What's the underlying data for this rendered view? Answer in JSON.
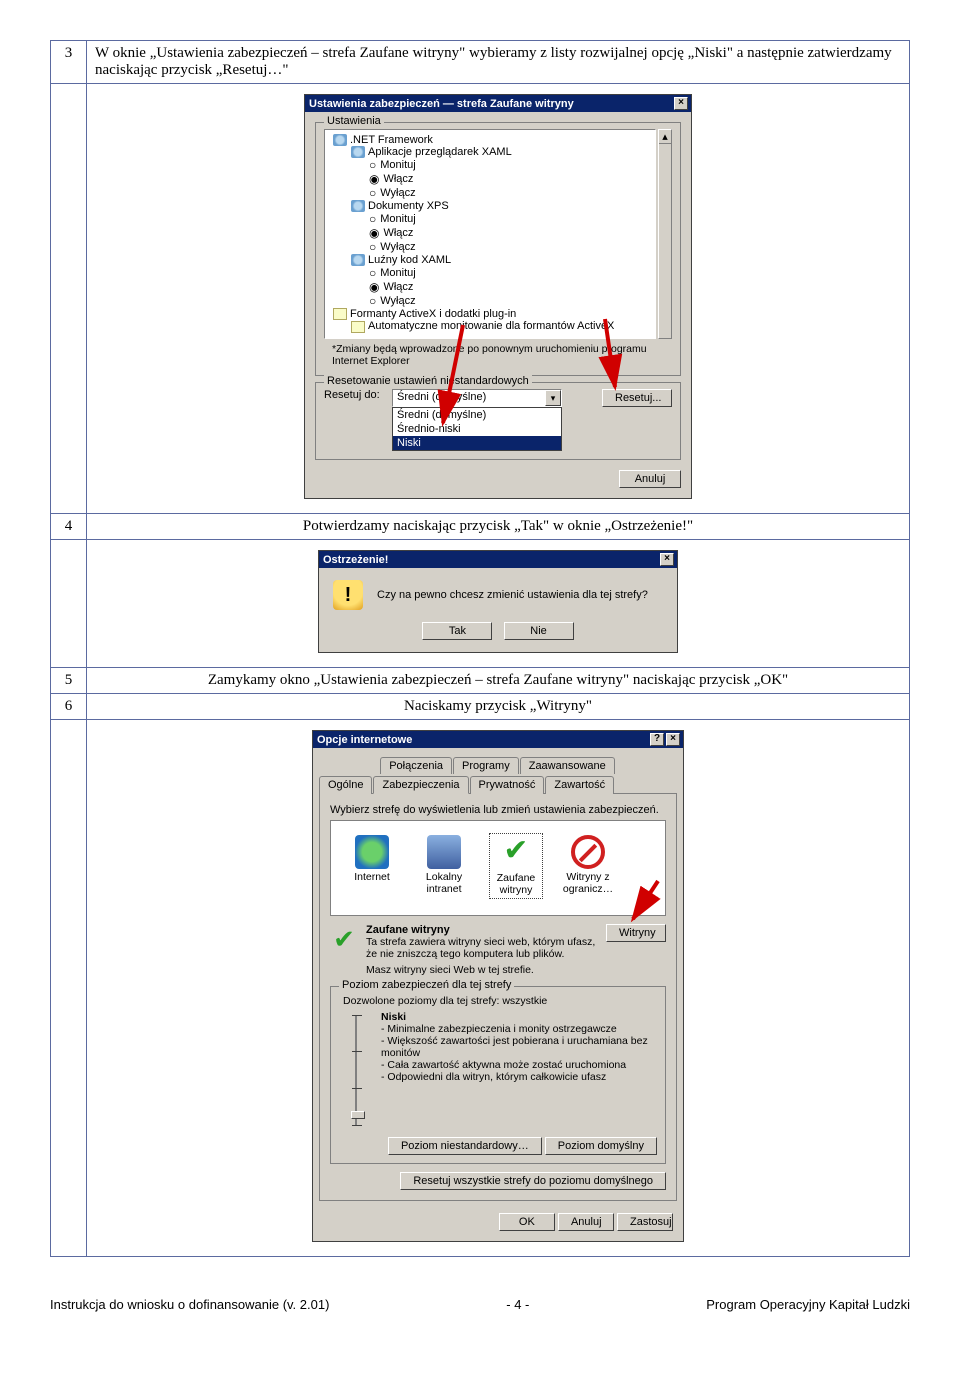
{
  "steps": {
    "s3": {
      "num": "3",
      "text": "W oknie „Ustawienia zabezpieczeń – strefa Zaufane witryny\" wybieramy z listy rozwijalnej opcję „Niski\" a następnie zatwierdzamy naciskając przycisk „Resetuj…\""
    },
    "s4": {
      "num": "4",
      "text": "Potwierdzamy naciskając przycisk „Tak\" w oknie „Ostrzeżenie!\""
    },
    "s5": {
      "num": "5",
      "text": "Zamykamy okno „Ustawienia zabezpieczeń – strefa Zaufane witryny\" naciskając przycisk „OK\""
    },
    "s6": {
      "num": "6",
      "text": "Naciskamy przycisk „Witryny\""
    }
  },
  "dlg1": {
    "title": "Ustawienia zabezpieczeń — strefa Zaufane witryny",
    "group_settings": "Ustawienia",
    "tree": {
      "net": ".NET Framework",
      "xaml_apps": "Aplikacje przeglądarek XAML",
      "monituj": "Monituj",
      "wlacz": "Włącz",
      "wylacz": "Wyłącz",
      "xps": "Dokumenty XPS",
      "loose_xaml": "Luźny kod XAML",
      "activex": "Formanty ActiveX i dodatki plug-in",
      "activex_auto": "Automatyczne monitowanie dla formantów ActiveX"
    },
    "note": "*Zmiany będą wprowadzone po ponownym uruchomieniu programu Internet Explorer",
    "group_reset": "Resetowanie ustawień niestandardowych",
    "reset_to": "Resetuj do:",
    "reset_btn": "Resetuj...",
    "combo": {
      "current": "Średni (domyślne)",
      "o1": "Średni (domyślne)",
      "o2": "Średnio-niski",
      "o3": "Niski"
    },
    "cancel": "Anuluj"
  },
  "dlg2": {
    "title": "Ostrzeżenie!",
    "msg": "Czy na pewno chcesz zmienić ustawienia dla tej strefy?",
    "yes": "Tak",
    "no": "Nie"
  },
  "dlg3": {
    "title": "Opcje internetowe",
    "tabs": {
      "polaczenia": "Połączenia",
      "programy": "Programy",
      "zaaw": "Zaawansowane",
      "ogolne": "Ogólne",
      "zabezp": "Zabezpieczenia",
      "pryw": "Prywatność",
      "zawart": "Zawartość"
    },
    "hint": "Wybierz strefę do wyświetlenia lub zmień ustawienia zabezpieczeń.",
    "zones": {
      "internet": "Internet",
      "intranet": "Lokalny intranet",
      "trusted": "Zaufane witryny",
      "restricted": "Witryny z ogranicz…"
    },
    "zone_title": "Zaufane witryny",
    "zone_desc1": "Ta strefa zawiera witryny sieci web, którym ufasz, że nie zniszczą tego komputera lub plików.",
    "zone_desc2": "Masz witryny sieci Web w tej strefie.",
    "sites_btn": "Witryny",
    "level_group": "Poziom zabezpieczeń dla tej strefy",
    "allowed": "Dozwolone poziomy dla tej strefy: wszystkie",
    "level_name": "Niski",
    "b1": "- Minimalne zabezpieczenia i monity ostrzegawcze",
    "b2": "- Większość zawartości jest pobierana i uruchamiana bez monitów",
    "b3": "- Cała zawartość aktywna może zostać uruchomiona",
    "b4": "- Odpowiedni dla witryn, którym całkowicie ufasz",
    "custom_btn": "Poziom niestandardowy…",
    "default_btn": "Poziom domyślny",
    "reset_all": "Resetuj wszystkie strefy do poziomu domyślnego",
    "ok": "OK",
    "cancel": "Anuluj",
    "apply": "Zastosuj"
  },
  "footer": {
    "left": "Instrukcja do wniosku o dofinansowanie (v. 2.01)",
    "mid": "- 4 -",
    "right": "Program Operacyjny Kapitał Ludzki"
  }
}
